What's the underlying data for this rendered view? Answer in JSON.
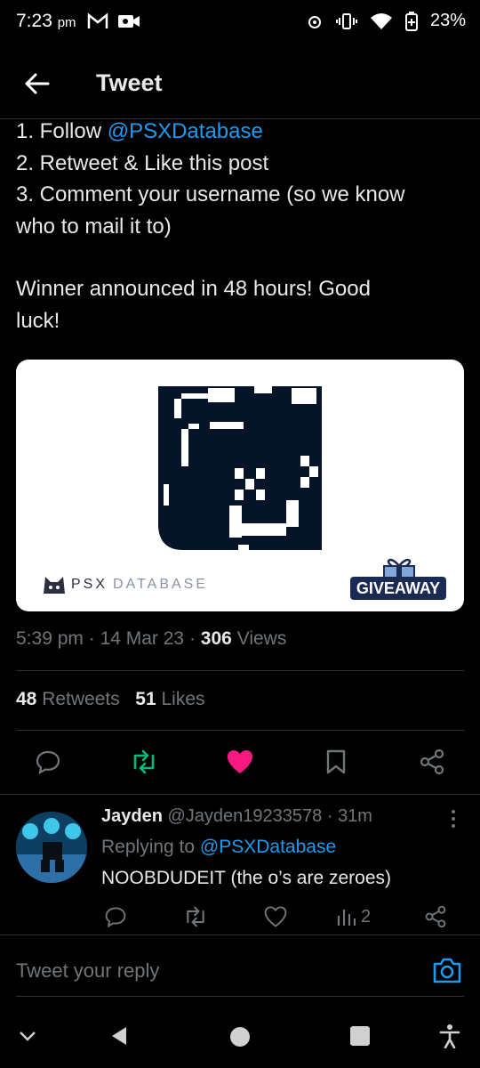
{
  "status_bar": {
    "time": "7:23",
    "ampm": "pm",
    "battery": "23%"
  },
  "header": {
    "title": "Tweet"
  },
  "tweet": {
    "line1_prefix": "1. Follow ",
    "line1_handle": "@PSXDatabase",
    "line2": "2. Retweet & Like this post",
    "line3": "3. Comment your username (so we know\nwho to mail it to)",
    "line4": "Winner announced in 48 hours! Good\nluck!",
    "card_brand_a": "PSX",
    "card_brand_b": "DATABASE",
    "card_giveaway": "GIVEAWAY",
    "time": "5:39 pm",
    "date": "14 Mar 23",
    "views_count": "306",
    "views_label": "Views",
    "retweets_count": "48",
    "retweets_label": "Retweets",
    "likes_count": "51",
    "likes_label": "Likes",
    "liked": true
  },
  "reply": {
    "name": "Jayden",
    "handle": "@Jayden19233578",
    "age": "31m",
    "replying_label": "Replying to",
    "replying_handle": "@PSXDatabase",
    "text": "NOOBDUDEIT (the o’s are zeroes)",
    "views": "2"
  },
  "composer": {
    "placeholder": "Tweet your reply"
  },
  "colors": {
    "accent": "#1d9bf0",
    "like": "#f91880",
    "retweet": "#00ba7c"
  }
}
